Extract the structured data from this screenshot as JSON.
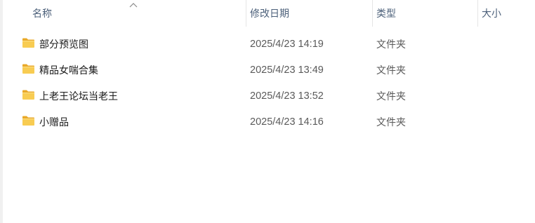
{
  "columns": {
    "name": "名称",
    "date_modified": "修改日期",
    "type": "类型",
    "size": "大小"
  },
  "sort": {
    "column": "name",
    "indicator": "chevron-up-icon"
  },
  "items": [
    {
      "name": "部分预览图",
      "date": "2025/4/23 14:19",
      "type": "文件夹",
      "icon": "folder-icon"
    },
    {
      "name": "精品女喘合集",
      "date": "2025/4/23 13:49",
      "type": "文件夹",
      "icon": "folder-icon"
    },
    {
      "name": "上老王论坛当老王",
      "date": "2025/4/23 13:52",
      "type": "文件夹",
      "icon": "folder-icon"
    },
    {
      "name": "小赠品",
      "date": "2025/4/23 14:16",
      "type": "文件夹",
      "icon": "folder-icon"
    }
  ],
  "colors": {
    "header_text": "#4c607a",
    "folder_body": "#f8cc52",
    "folder_back": "#e9a928"
  }
}
